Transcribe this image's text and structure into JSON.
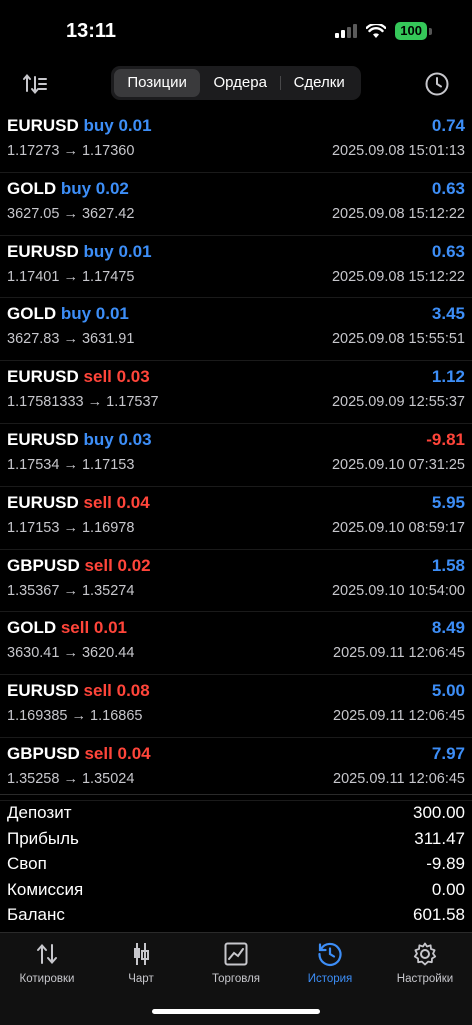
{
  "status": {
    "time": "13:11",
    "battery": "100"
  },
  "segments": [
    {
      "label": "Позиции",
      "active": true
    },
    {
      "label": "Ордера",
      "active": false
    },
    {
      "label": "Сделки",
      "active": false
    }
  ],
  "deals": [
    {
      "symbol": "EURUSD",
      "side": "buy 0.01",
      "type": "buy",
      "profit": "0.74",
      "sign": "pos",
      "prices": "1.17273 → 1.17360",
      "time": "2025.09.08 15:01:13"
    },
    {
      "symbol": "GOLD",
      "side": "buy 0.02",
      "type": "buy",
      "profit": "0.63",
      "sign": "pos",
      "prices": "3627.05 → 3627.42",
      "time": "2025.09.08 15:12:22"
    },
    {
      "symbol": "EURUSD",
      "side": "buy 0.01",
      "type": "buy",
      "profit": "0.63",
      "sign": "pos",
      "prices": "1.17401 → 1.17475",
      "time": "2025.09.08 15:12:22"
    },
    {
      "symbol": "GOLD",
      "side": "buy 0.01",
      "type": "buy",
      "profit": "3.45",
      "sign": "pos",
      "prices": "3627.83 → 3631.91",
      "time": "2025.09.08 15:55:51"
    },
    {
      "symbol": "EURUSD",
      "side": "sell 0.03",
      "type": "sell",
      "profit": "1.12",
      "sign": "pos",
      "prices": "1.17581333 → 1.17537",
      "time": "2025.09.09 12:55:37"
    },
    {
      "symbol": "EURUSD",
      "side": "buy 0.03",
      "type": "buy",
      "profit": "-9.81",
      "sign": "neg",
      "prices": "1.17534 → 1.17153",
      "time": "2025.09.10 07:31:25"
    },
    {
      "symbol": "EURUSD",
      "side": "sell 0.04",
      "type": "sell",
      "profit": "5.95",
      "sign": "pos",
      "prices": "1.17153 → 1.16978",
      "time": "2025.09.10 08:59:17"
    },
    {
      "symbol": "GBPUSD",
      "side": "sell 0.02",
      "type": "sell",
      "profit": "1.58",
      "sign": "pos",
      "prices": "1.35367 → 1.35274",
      "time": "2025.09.10 10:54:00"
    },
    {
      "symbol": "GOLD",
      "side": "sell 0.01",
      "type": "sell",
      "profit": "8.49",
      "sign": "pos",
      "prices": "3630.41 → 3620.44",
      "time": "2025.09.11 12:06:45"
    },
    {
      "symbol": "EURUSD",
      "side": "sell 0.08",
      "type": "sell",
      "profit": "5.00",
      "sign": "pos",
      "prices": "1.169385 → 1.16865",
      "time": "2025.09.11 12:06:45"
    },
    {
      "symbol": "GBPUSD",
      "side": "sell 0.04",
      "type": "sell",
      "profit": "7.97",
      "sign": "pos",
      "prices": "1.35258 → 1.35024",
      "time": "2025.09.11 12:06:45"
    }
  ],
  "summary": [
    {
      "label": "Депозит",
      "value": "300.00"
    },
    {
      "label": "Прибыль",
      "value": "311.47"
    },
    {
      "label": "Своп",
      "value": "-9.89"
    },
    {
      "label": "Комиссия",
      "value": "0.00"
    },
    {
      "label": "Баланс",
      "value": "601.58"
    }
  ],
  "tabs": [
    {
      "label": "Котировки",
      "icon": "quotes-icon",
      "active": false
    },
    {
      "label": "Чарт",
      "icon": "chart-icon",
      "active": false
    },
    {
      "label": "Торговля",
      "icon": "trade-icon",
      "active": false
    },
    {
      "label": "История",
      "icon": "history-icon",
      "active": true
    },
    {
      "label": "Настройки",
      "icon": "settings-icon",
      "active": false
    }
  ],
  "colors": {
    "accent": "#3d8ef7",
    "sell": "#ff453a",
    "battery": "#35c759"
  }
}
